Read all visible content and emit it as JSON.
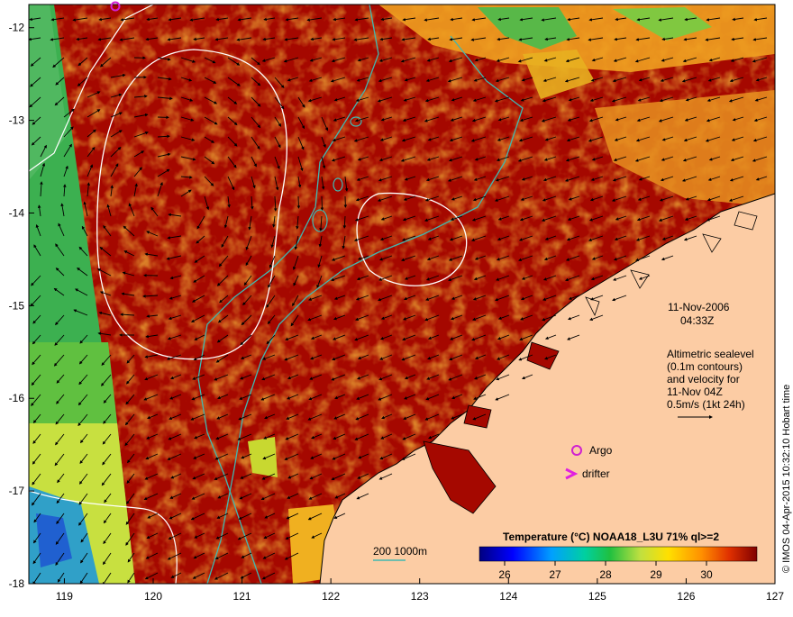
{
  "map": {
    "lon_ticks": [
      "119",
      "120",
      "121",
      "122",
      "123",
      "124",
      "125",
      "126",
      "127"
    ],
    "lat_ticks": [
      "-12",
      "-13",
      "-14",
      "-15",
      "-16",
      "-17",
      "-18"
    ],
    "lon_range": [
      118.6,
      127.0
    ],
    "lat_range": [
      -18.0,
      -11.75
    ],
    "date_label": "11-Nov-2006",
    "time_label": "04:33Z",
    "info_lines": [
      "Altimetric sealevel",
      "(0.1m contours)",
      "and velocity for",
      "11-Nov 04Z",
      "0.5m/s (1kt 24h)"
    ],
    "argo_label": "Argo",
    "drifter_label": "drifter",
    "argo_symbol": "o",
    "drifter_symbol": ">",
    "depth_label": "200  1000m",
    "colorbar_title": "Temperature (°C) NOAA18_L3U 71% ql>=2",
    "colorbar_ticks": [
      "26",
      "27",
      "28",
      "29",
      "30"
    ],
    "colorbar_range": [
      25.5,
      31.0
    ],
    "stamp": "© IMOS 04-Apr-2015 10:32:10 Hobart time",
    "colors": {
      "warm_sea": "#a50800",
      "land": "#fccca4",
      "contour": "#ffffff",
      "isobath": "#40b8b0",
      "argo": "#d020d0",
      "drifter": "#e020e0"
    }
  }
}
